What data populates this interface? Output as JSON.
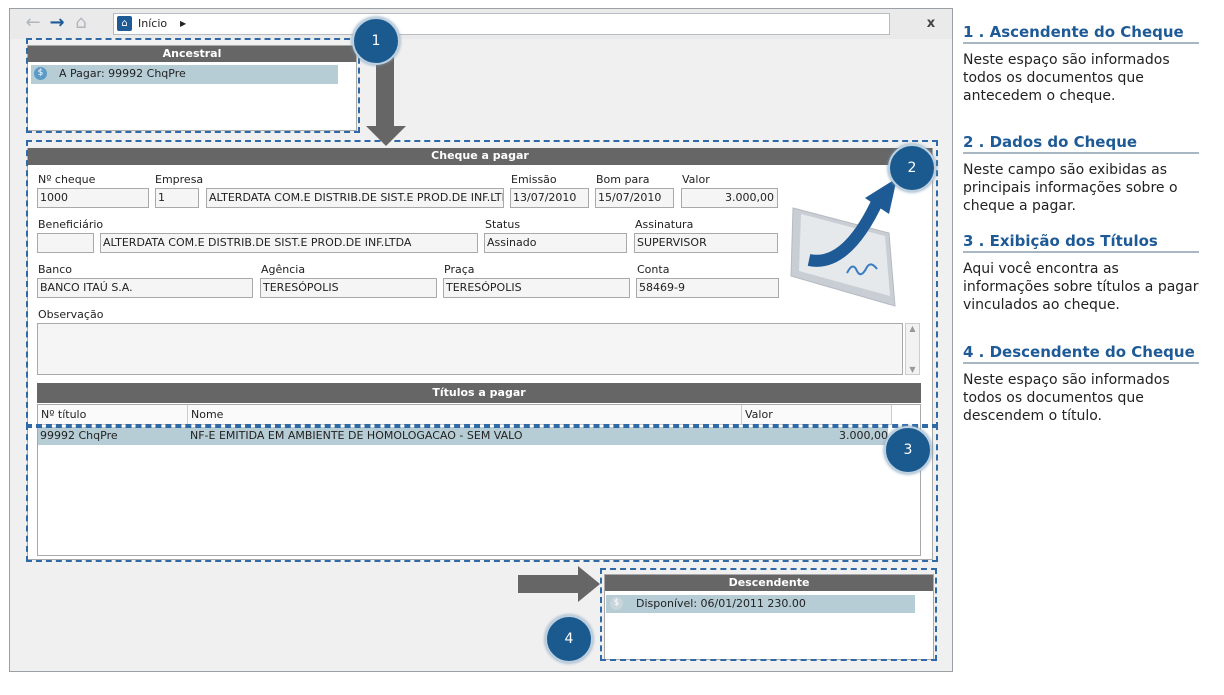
{
  "browser": {
    "address": "Início",
    "close": "x"
  },
  "ancestral": {
    "title": "Ancestral",
    "item": "A Pagar: 99992 ChqPre"
  },
  "cheque": {
    "title": "Cheque a pagar",
    "labels": {
      "numero": "Nº cheque",
      "empresa": "Empresa",
      "emissao": "Emissão",
      "bom_para": "Bom para",
      "valor": "Valor",
      "beneficiario": "Beneficiário",
      "status": "Status",
      "assinatura": "Assinatura",
      "banco": "Banco",
      "agencia": "Agência",
      "praca": "Praça",
      "conta": "Conta",
      "observacao": "Observação"
    },
    "values": {
      "numero": "1000",
      "empresa_cod": "1",
      "empresa_nome": "ALTERDATA COM.E DISTRIB.DE SIST.E PROD.DE INF.LTDA",
      "emissao": "13/07/2010",
      "bom_para": "15/07/2010",
      "valor": "3.000,00",
      "beneficiario_cod": "",
      "beneficiario_nome": "ALTERDATA COM.E DISTRIB.DE SIST.E PROD.DE INF.LTDA",
      "status": "Assinado",
      "assinatura": "SUPERVISOR",
      "banco": "BANCO ITAÚ S.A.",
      "agencia": "TERESÓPOLIS",
      "praca": "TERESÓPOLIS",
      "conta": "58469-9",
      "observacao": ""
    }
  },
  "titulos": {
    "title": "Títulos a pagar",
    "columns": [
      "Nº título",
      "Nome",
      "Valor"
    ],
    "rows": [
      {
        "numero": "99992 ChqPre",
        "nome": "NF-E EMITIDA EM AMBIENTE DE HOMOLOGACAO - SEM VALO",
        "valor": "3.000,00"
      }
    ]
  },
  "descendente": {
    "title": "Descendente",
    "item": "Disponível: 06/01/2011  230.00"
  },
  "badges": [
    "1",
    "2",
    "3",
    "4"
  ],
  "side": [
    {
      "title": "1 . Ascendente do Cheque",
      "text": "Neste espaço são informados todos os documentos que antecedem o cheque."
    },
    {
      "title": "2 . Dados do Cheque",
      "text": "Neste campo são exibidas as principais informações sobre o cheque a pagar."
    },
    {
      "title": "3 . Exibição dos Títulos",
      "text": "Aqui você encontra as informações sobre títulos a pagar vinculados ao cheque."
    },
    {
      "title": "4 . Descendente do Cheque",
      "text": "Neste espaço são informados todos os documentos que descendem o título."
    }
  ],
  "colors": {
    "accent": "#1e5a96",
    "header": "#666666",
    "highlight": "#b7cdd6"
  }
}
